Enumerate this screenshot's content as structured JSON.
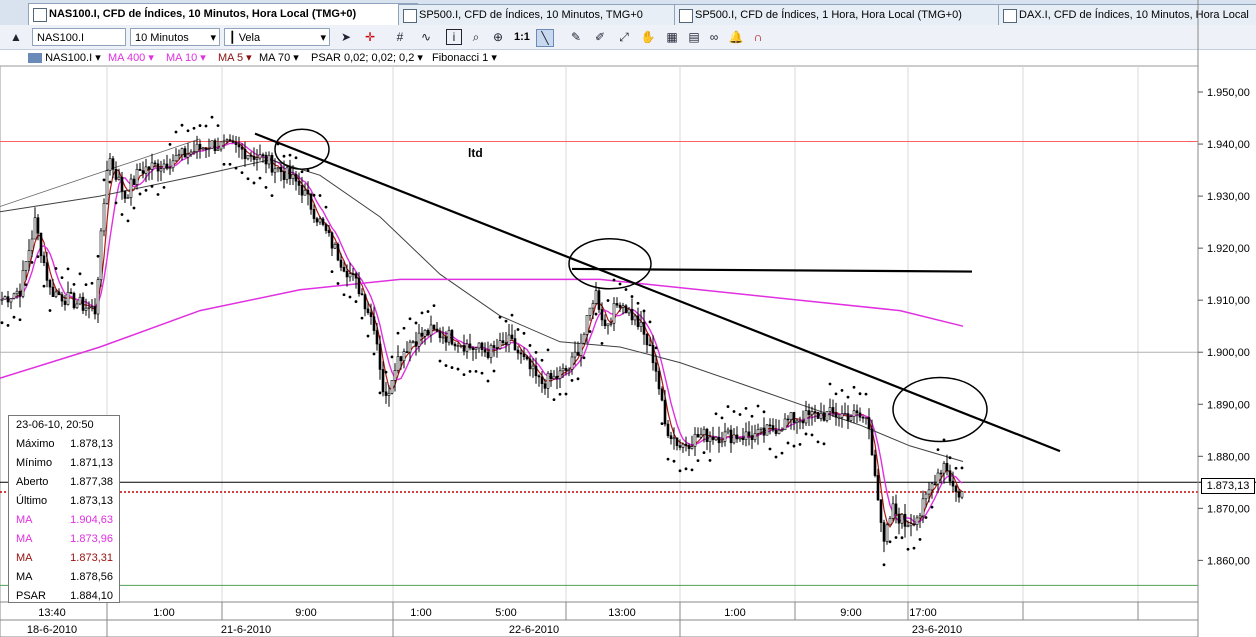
{
  "tabs": [
    {
      "label": "NAS100.I, CFD de Índices, 10 Minutos, Hora Local (TMG+0)",
      "close": "✕",
      "active": true
    },
    {
      "label": "SP500.I, CFD de Índices, 10 Minutos, TMG+0",
      "active": false
    },
    {
      "label": "SP500.I, CFD de Índices, 1 Hora, Hora Local (TMG+0)",
      "active": false
    },
    {
      "label": "DAX.I, CFD de Índices, 10 Minutos, Hora Local",
      "active": false
    }
  ],
  "toolbar": {
    "symbol": "NAS100.I",
    "interval": "10 Minutos",
    "chart_type": "Vela",
    "zoom_label": "1:1"
  },
  "indicators": {
    "symbol": "NAS100.I",
    "ma400": "MA 400",
    "ma10": "MA 10",
    "ma5": "MA 5",
    "ma70": "MA 70",
    "psar": "PSAR 0,02; 0,02; 0,2",
    "fibonacci": "Fibonacci 1"
  },
  "colors": {
    "up": "#ffffff",
    "down": "#000000",
    "ma400": "#e030e0",
    "ma10": "#e030e0",
    "ma5": "#b01818",
    "ma70": "#404040",
    "psar": "#000000",
    "price_line": "#cc0000",
    "resistance": "#ff6060"
  },
  "info": {
    "title": "23-06-10, 20:50",
    "rows": [
      {
        "k": "Máximo",
        "v": "1.878,13",
        "c": "#000"
      },
      {
        "k": "Mínimo",
        "v": "1.871,13",
        "c": "#000"
      },
      {
        "k": "Aberto",
        "v": "1.877,38",
        "c": "#000"
      },
      {
        "k": "Último",
        "v": "1.873,13",
        "c": "#000"
      },
      {
        "k": "MA",
        "v": "1.904,63",
        "c": "#e030e0"
      },
      {
        "k": "MA",
        "v": "1.873,96",
        "c": "#e030e0"
      },
      {
        "k": "MA",
        "v": "1.873,31",
        "c": "#9a1010"
      },
      {
        "k": "MA",
        "v": "1.878,56",
        "c": "#000"
      },
      {
        "k": "PSAR",
        "v": "1.884,10",
        "c": "#000"
      }
    ]
  },
  "annotation": "ltd",
  "price_tag": "1.873,13",
  "chart_data": {
    "type": "candlestick",
    "symbol": "NAS100.I",
    "interval": "10 Minutos",
    "ylim": [
      1852,
      1955
    ],
    "y_ticks": [
      1860,
      1870,
      1880,
      1890,
      1900,
      1910,
      1920,
      1930,
      1940,
      1950
    ],
    "y_tick_labels": [
      "1.860,00",
      "1.870,00",
      "1.880,00",
      "1.890,00",
      "1.900,00",
      "1.910,00",
      "1.920,00",
      "1.930,00",
      "1.940,00",
      "1.950,00"
    ],
    "x_time_labels": [
      "13:40",
      "1:00",
      "9:00",
      "1:00",
      "5:00",
      "13:00",
      "1:00",
      "9:00",
      "17:00"
    ],
    "x_date_labels": [
      "18-6-2010",
      "21-6-2010",
      "22-6-2010",
      "23-6-2010"
    ],
    "close_path": [
      [
        0,
        1910
      ],
      [
        20,
        1912
      ],
      [
        35,
        1925
      ],
      [
        50,
        1912
      ],
      [
        70,
        1910
      ],
      [
        95,
        1908
      ],
      [
        108,
        1938
      ],
      [
        125,
        1930
      ],
      [
        140,
        1935
      ],
      [
        160,
        1936
      ],
      [
        185,
        1938
      ],
      [
        210,
        1940
      ],
      [
        240,
        1939
      ],
      [
        265,
        1937
      ],
      [
        280,
        1935
      ],
      [
        300,
        1932
      ],
      [
        320,
        1925
      ],
      [
        340,
        1918
      ],
      [
        360,
        1912
      ],
      [
        375,
        1905
      ],
      [
        385,
        1890
      ],
      [
        395,
        1898
      ],
      [
        410,
        1902
      ],
      [
        430,
        1904
      ],
      [
        450,
        1903
      ],
      [
        470,
        1901
      ],
      [
        490,
        1900
      ],
      [
        510,
        1902
      ],
      [
        525,
        1898
      ],
      [
        540,
        1894
      ],
      [
        555,
        1895
      ],
      [
        570,
        1897
      ],
      [
        585,
        1904
      ],
      [
        595,
        1912
      ],
      [
        605,
        1905
      ],
      [
        620,
        1910
      ],
      [
        640,
        1905
      ],
      [
        655,
        1898
      ],
      [
        665,
        1886
      ],
      [
        680,
        1882
      ],
      [
        700,
        1884
      ],
      [
        730,
        1884
      ],
      [
        760,
        1884
      ],
      [
        790,
        1887
      ],
      [
        820,
        1888
      ],
      [
        850,
        1888
      ],
      [
        868,
        1887
      ],
      [
        876,
        1876
      ],
      [
        883,
        1862
      ],
      [
        892,
        1870
      ],
      [
        905,
        1867
      ],
      [
        920,
        1869
      ],
      [
        935,
        1876
      ],
      [
        945,
        1879
      ],
      [
        955,
        1873
      ],
      [
        962,
        1873
      ]
    ],
    "ma400_path": [
      [
        0,
        1895
      ],
      [
        100,
        1901
      ],
      [
        200,
        1908
      ],
      [
        300,
        1912
      ],
      [
        400,
        1914
      ],
      [
        500,
        1914
      ],
      [
        600,
        1914
      ],
      [
        700,
        1912
      ],
      [
        800,
        1910
      ],
      [
        900,
        1908
      ],
      [
        963,
        1905
      ]
    ],
    "ma70_path": [
      [
        0,
        1927
      ],
      [
        100,
        1930
      ],
      [
        200,
        1934
      ],
      [
        270,
        1937
      ],
      [
        320,
        1934
      ],
      [
        380,
        1926
      ],
      [
        440,
        1915
      ],
      [
        500,
        1907
      ],
      [
        560,
        1902
      ],
      [
        620,
        1901
      ],
      [
        680,
        1898
      ],
      [
        740,
        1894
      ],
      [
        800,
        1890
      ],
      [
        860,
        1886
      ],
      [
        910,
        1882
      ],
      [
        963,
        1879
      ]
    ],
    "resistance_level": 1940.5,
    "support_levels": [
      1875,
      1855.2
    ],
    "last_price": 1873.13,
    "annotations": [
      {
        "type": "trendline",
        "from": [
          255,
          1942
        ],
        "to": [
          1060,
          1881
        ]
      },
      {
        "type": "hline",
        "from": [
          572,
          1916
        ],
        "to": [
          972,
          1915.5
        ]
      },
      {
        "type": "circle",
        "at": [
          302,
          1939
        ]
      },
      {
        "type": "circle",
        "at": [
          610,
          1917
        ]
      },
      {
        "type": "circle",
        "at": [
          940,
          1889
        ]
      }
    ]
  }
}
